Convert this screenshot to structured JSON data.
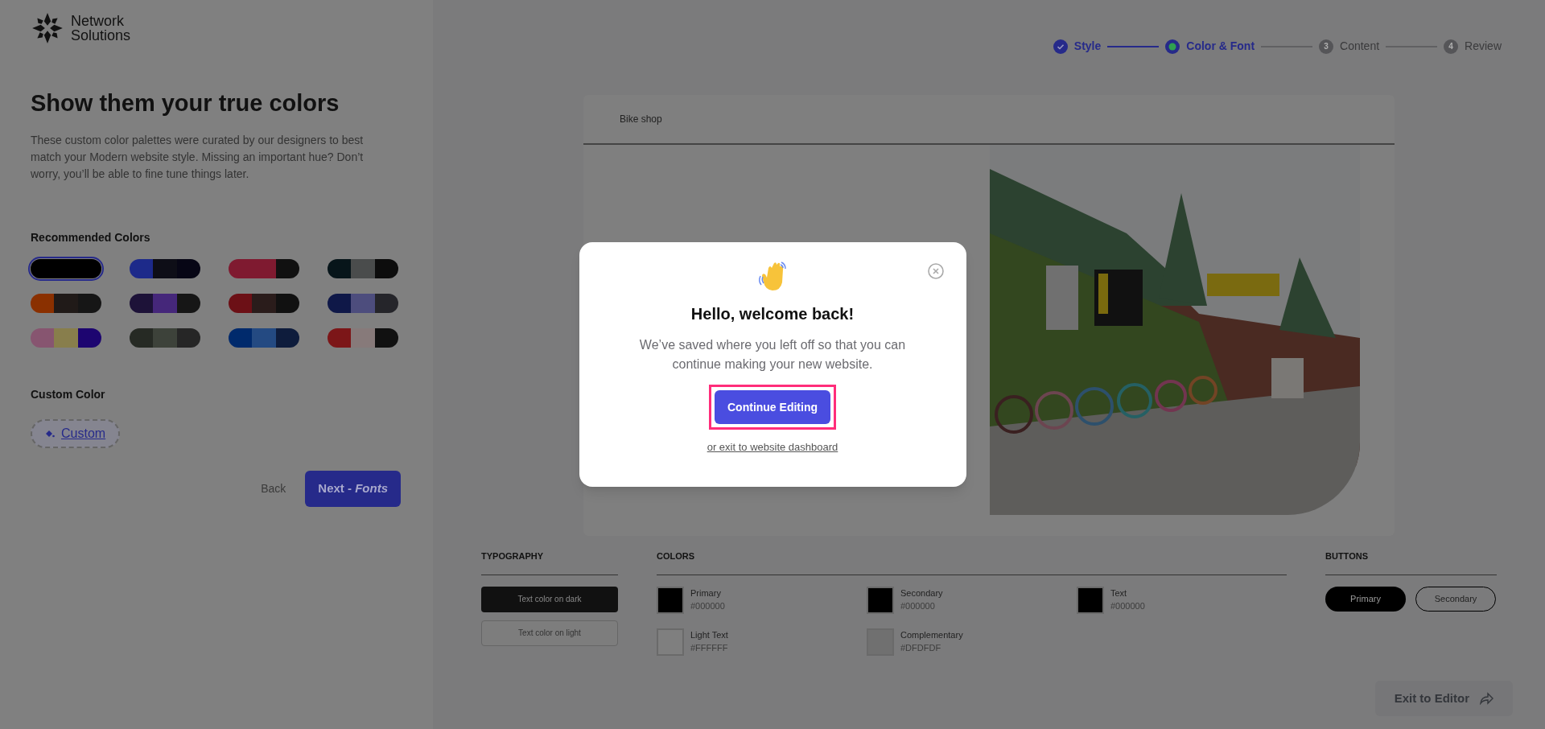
{
  "brand": {
    "name": "Network Solutions"
  },
  "intro": {
    "title": "Show them your true colors",
    "description": "These custom color palettes were curated by our designers to best match your Modern website style. Missing an important hue? Don’t worry, you’ll be able to fine tune things later."
  },
  "recommended": {
    "heading": "Recommended Colors",
    "palettes": [
      {
        "selected": true,
        "segments": [
          {
            "color": "#000000"
          },
          {
            "color": "#000000"
          },
          {
            "color": "#000000"
          }
        ]
      },
      {
        "selected": false,
        "segments": [
          {
            "color": "#1d2a8a"
          },
          {
            "color": "#0e0e17"
          },
          {
            "color": "#070615"
          }
        ]
      },
      {
        "selected": false,
        "segments": [
          {
            "color": "#7f1a30"
          },
          {
            "color": "#7f1a30"
          },
          {
            "color": "#111111"
          }
        ]
      },
      {
        "selected": false,
        "segments": [
          {
            "color": "#07151a"
          },
          {
            "color": "#4a4c4c"
          },
          {
            "color": "#0d0d0d"
          }
        ]
      },
      {
        "selected": false,
        "segments": [
          {
            "color": "#8a3000"
          },
          {
            "color": "#201a18"
          },
          {
            "color": "#161616"
          }
        ]
      },
      {
        "selected": false,
        "segments": [
          {
            "color": "#1d1238"
          },
          {
            "color": "#45277a"
          },
          {
            "color": "#161616"
          }
        ]
      },
      {
        "selected": false,
        "segments": [
          {
            "color": "#6c1016"
          },
          {
            "color": "#2a1c1b"
          },
          {
            "color": "#111111"
          }
        ]
      },
      {
        "selected": false,
        "segments": [
          {
            "color": "#0f1848"
          },
          {
            "color": "#4d4d7d"
          },
          {
            "color": "#25252a"
          }
        ]
      },
      {
        "selected": false,
        "segments": [
          {
            "color": "#875570"
          },
          {
            "color": "#887e4c"
          },
          {
            "color": "#1d0570"
          }
        ]
      },
      {
        "selected": false,
        "segments": [
          {
            "color": "#262a24"
          },
          {
            "color": "#3d423a"
          },
          {
            "color": "#262626"
          }
        ]
      },
      {
        "selected": false,
        "segments": [
          {
            "color": "#002a6c"
          },
          {
            "color": "#244a82"
          },
          {
            "color": "#0e1c3c"
          }
        ]
      },
      {
        "selected": false,
        "segments": [
          {
            "color": "#7c1618"
          },
          {
            "color": "#877a7a"
          },
          {
            "color": "#111111"
          }
        ]
      }
    ]
  },
  "custom": {
    "heading": "Custom Color",
    "button": "Custom"
  },
  "nav": {
    "back": "Back",
    "next": "Next -  *Fonts*"
  },
  "steps": [
    {
      "label": "Style",
      "completed": true,
      "selected": false
    },
    {
      "label": "Color & Font",
      "completed": false,
      "selected": true
    },
    {
      "label": "Content",
      "number": "3",
      "completed": false,
      "selected": false
    },
    {
      "label": "Review",
      "number": "4",
      "completed": false,
      "selected": false
    }
  ],
  "preview": {
    "site_name": "Bike shop"
  },
  "style_guide": {
    "typography": {
      "heading": "TYPOGRAPHY",
      "samples": [
        {
          "label": "Text color on dark",
          "kind": "dark"
        },
        {
          "label": "Text color on light",
          "kind": "light"
        }
      ]
    },
    "colors": {
      "heading": "COLORS",
      "swatches": [
        {
          "name": "Primary",
          "hex": "#000000",
          "color": "#000000"
        },
        {
          "name": "Secondary",
          "hex": "#000000",
          "color": "#000000"
        },
        {
          "name": "Text",
          "hex": "#000000",
          "color": "#000000"
        },
        {
          "name": "Light Text",
          "hex": "#FFFFFF",
          "color": "#7f7f7f"
        },
        {
          "name": "Complementary",
          "hex": "#DFDFDF",
          "color": "#707070"
        }
      ]
    },
    "buttons": {
      "heading": "BUTTONS",
      "samples": [
        {
          "label": "Primary",
          "kind": "primary"
        },
        {
          "label": "Secondary",
          "kind": "secondary"
        }
      ]
    }
  },
  "exit_button": {
    "label": "Exit to Editor"
  },
  "modal": {
    "title": "Hello, welcome back!",
    "message": "We’ve saved where you left off so that you can continue making your new website.",
    "primary": {
      "label": "Continue Editing",
      "highlighted": true
    },
    "link": "or exit to website dashboard"
  }
}
